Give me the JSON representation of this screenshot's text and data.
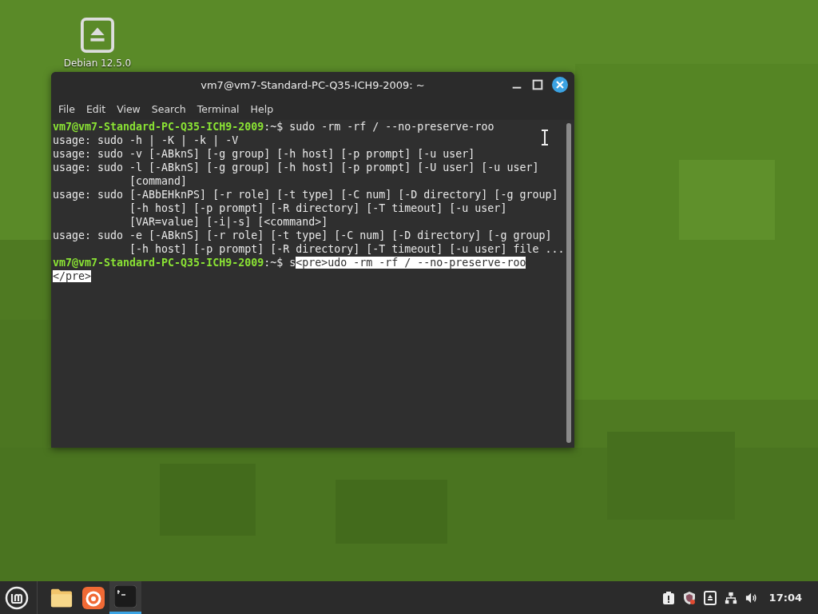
{
  "desktop": {
    "icons": [
      {
        "label": "Debian 12.5.0"
      }
    ]
  },
  "window": {
    "title": "vm7@vm7-Standard-PC-Q35-ICH9-2009: ~",
    "menu": [
      "File",
      "Edit",
      "View",
      "Search",
      "Terminal",
      "Help"
    ],
    "lines": [
      {
        "kind": "prompt",
        "prompt": "vm7@vm7-Standard-PC-Q35-ICH9-2009",
        "path": ":~$",
        "command": "sudo -rm -rf / --no-preserve-roo"
      },
      {
        "kind": "output",
        "text": "usage: sudo -h | -K | -k | -V"
      },
      {
        "kind": "output",
        "text": "usage: sudo -v [-ABknS] [-g group] [-h host] [-p prompt] [-u user]"
      },
      {
        "kind": "output",
        "text": "usage: sudo -l [-ABknS] [-g group] [-h host] [-p prompt] [-U user] [-u user]"
      },
      {
        "kind": "output",
        "text": "            [command]"
      },
      {
        "kind": "output",
        "text": "usage: sudo [-ABbEHknPS] [-r role] [-t type] [-C num] [-D directory] [-g group]"
      },
      {
        "kind": "output",
        "text": "            [-h host] [-p prompt] [-R directory] [-T timeout] [-u user]"
      },
      {
        "kind": "output",
        "text": "            [VAR=value] [-i|-s] [<command>]"
      },
      {
        "kind": "output",
        "text": "usage: sudo -e [-ABknS] [-r role] [-t type] [-C num] [-D directory] [-g group]"
      },
      {
        "kind": "output",
        "text": "            [-h host] [-p prompt] [-R directory] [-T timeout] [-u user] file ..."
      },
      {
        "kind": "prompt",
        "prompt": "vm7@vm7-Standard-PC-Q35-ICH9-2009",
        "path": ":~$",
        "command": "s",
        "selection": "<pre>udo -rm -rf / --no-preserve-roo"
      },
      {
        "kind": "output",
        "selection": "</pre>"
      }
    ]
  },
  "taskbar": {
    "apps": [
      {
        "kind": "files",
        "active": false
      },
      {
        "kind": "browser",
        "active": false
      },
      {
        "kind": "terminal",
        "active": true
      }
    ],
    "clock": "17:04"
  }
}
